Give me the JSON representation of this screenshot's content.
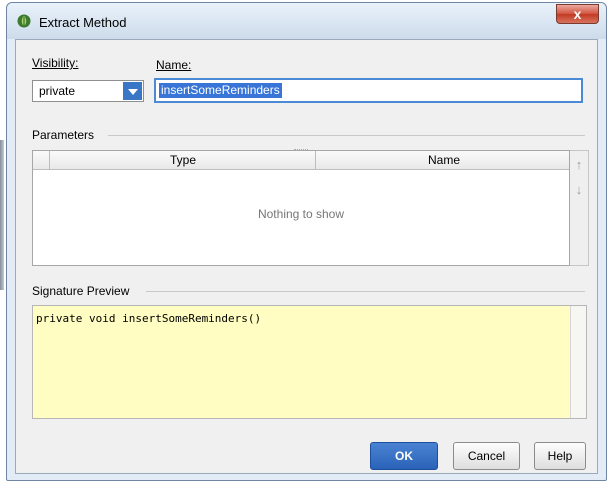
{
  "window": {
    "title": "Extract Method",
    "close_label": "x"
  },
  "visibility": {
    "label": "Visibility:",
    "value": "private"
  },
  "name": {
    "label": "Name:",
    "value": "insertSomeReminders"
  },
  "parameters": {
    "label": "Parameters",
    "columns": [
      "Type",
      "Name"
    ],
    "empty_text": "Nothing to show",
    "move_up_icon": "arrow-up-icon",
    "move_down_icon": "arrow-down-icon"
  },
  "signature_preview": {
    "label": "Signature Preview",
    "text": "private void insertSomeReminders()"
  },
  "buttons": {
    "ok": "OK",
    "cancel": "Cancel",
    "help": "Help"
  },
  "colors": {
    "accent": "#3875d7",
    "preview_bg": "#fffdc1",
    "ok_button": "#2a62b8"
  }
}
